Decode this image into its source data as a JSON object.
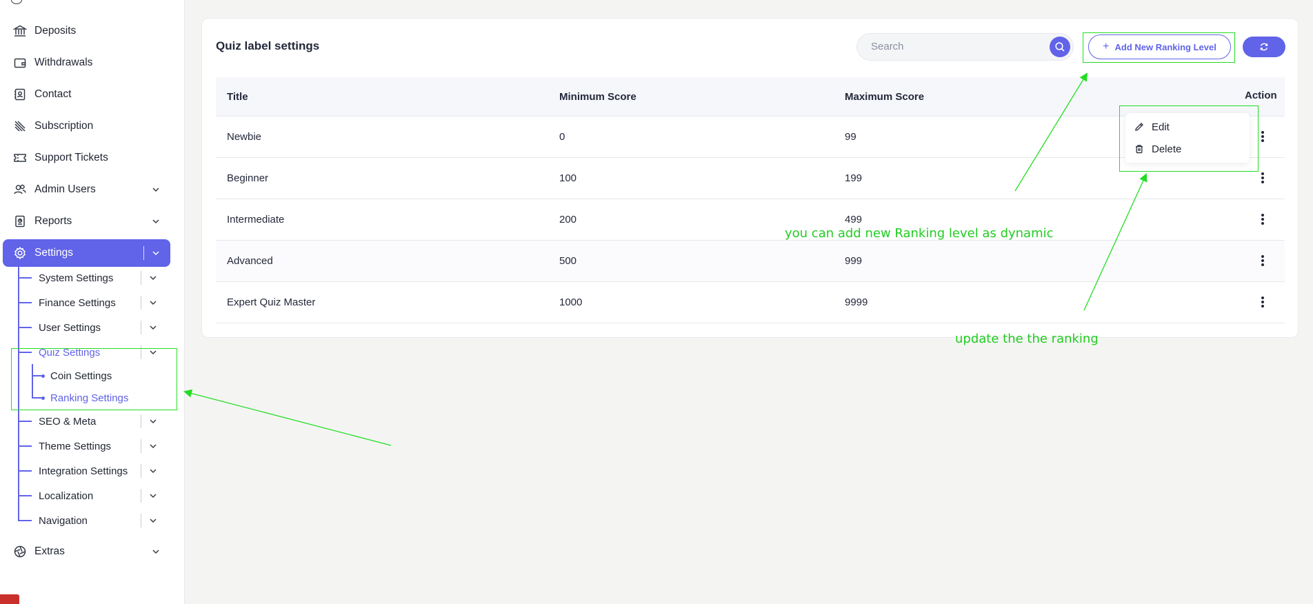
{
  "sidebar": {
    "items": [
      {
        "label": "Deposits",
        "icon": "bank-icon"
      },
      {
        "label": "Withdrawals",
        "icon": "wallet-icon"
      },
      {
        "label": "Contact",
        "icon": "contact-card-icon"
      },
      {
        "label": "Subscription",
        "icon": "subscription-icon"
      },
      {
        "label": "Support Tickets",
        "icon": "ticket-icon"
      },
      {
        "label": "Admin Users",
        "icon": "users-icon"
      },
      {
        "label": "Reports",
        "icon": "reports-icon"
      },
      {
        "label": "Settings",
        "icon": "gear-icon"
      },
      {
        "label": "Extras",
        "icon": "aperture-icon"
      }
    ],
    "settings_children": [
      "System Settings",
      "Finance Settings",
      "User Settings",
      "Quiz Settings",
      "SEO & Meta",
      "Theme Settings",
      "Integration Settings",
      "Localization",
      "Navigation"
    ],
    "quiz_children": [
      "Coin Settings",
      "Ranking Settings"
    ]
  },
  "main": {
    "title": "Quiz label settings",
    "search_placeholder": "Search",
    "add_button_label": "Add New Ranking Level",
    "table": {
      "columns": [
        "Title",
        "Minimum Score",
        "Maximum Score",
        "Action"
      ],
      "rows": [
        [
          "Newbie",
          "0",
          "99"
        ],
        [
          "Beginner",
          "100",
          "199"
        ],
        [
          "Intermediate",
          "200",
          "499"
        ],
        [
          "Advanced",
          "500",
          "999"
        ],
        [
          "Expert Quiz Master",
          "1000",
          "9999"
        ]
      ]
    },
    "action_menu": {
      "edit": "Edit",
      "delete": "Delete"
    }
  },
  "annotations": {
    "add_note": "you can add new Ranking level as dynamic",
    "update_note": "update the the ranking"
  },
  "colors": {
    "accent": "#6163e8",
    "annotation": "#22dd22"
  }
}
